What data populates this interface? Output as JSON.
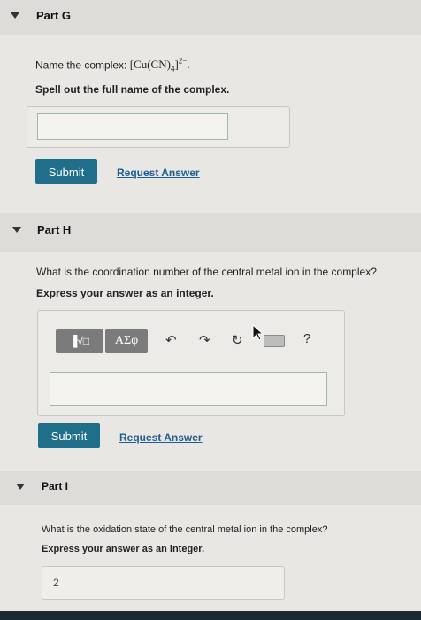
{
  "part_g": {
    "title": "Part G",
    "question_prefix": "Name the complex: ",
    "formula": {
      "open": "[Cu(CN)",
      "sub": "4",
      "close": "]",
      "sup": "2−",
      "end": "."
    },
    "instruction": "Spell out the full name of the complex.",
    "answer_value": "",
    "submit_label": "Submit",
    "request_label": "Request Answer"
  },
  "part_h": {
    "title": "Part H",
    "question": "What is the coordination number of the central metal ion in the complex?",
    "instruction": "Express your answer as an integer.",
    "toolbar": {
      "template_label": "▐√□",
      "symbols_label": "ΑΣφ",
      "undo_icon": "↶",
      "redo_icon": "↷",
      "reset_icon": "↻",
      "help_label": "?"
    },
    "answer_value": "",
    "submit_label": "Submit",
    "request_label": "Request Answer"
  },
  "part_i": {
    "title": "Part I",
    "question": "What is the oxidation state of the central metal ion in the complex?",
    "instruction": "Express your answer as an integer.",
    "answer_value": "2"
  }
}
